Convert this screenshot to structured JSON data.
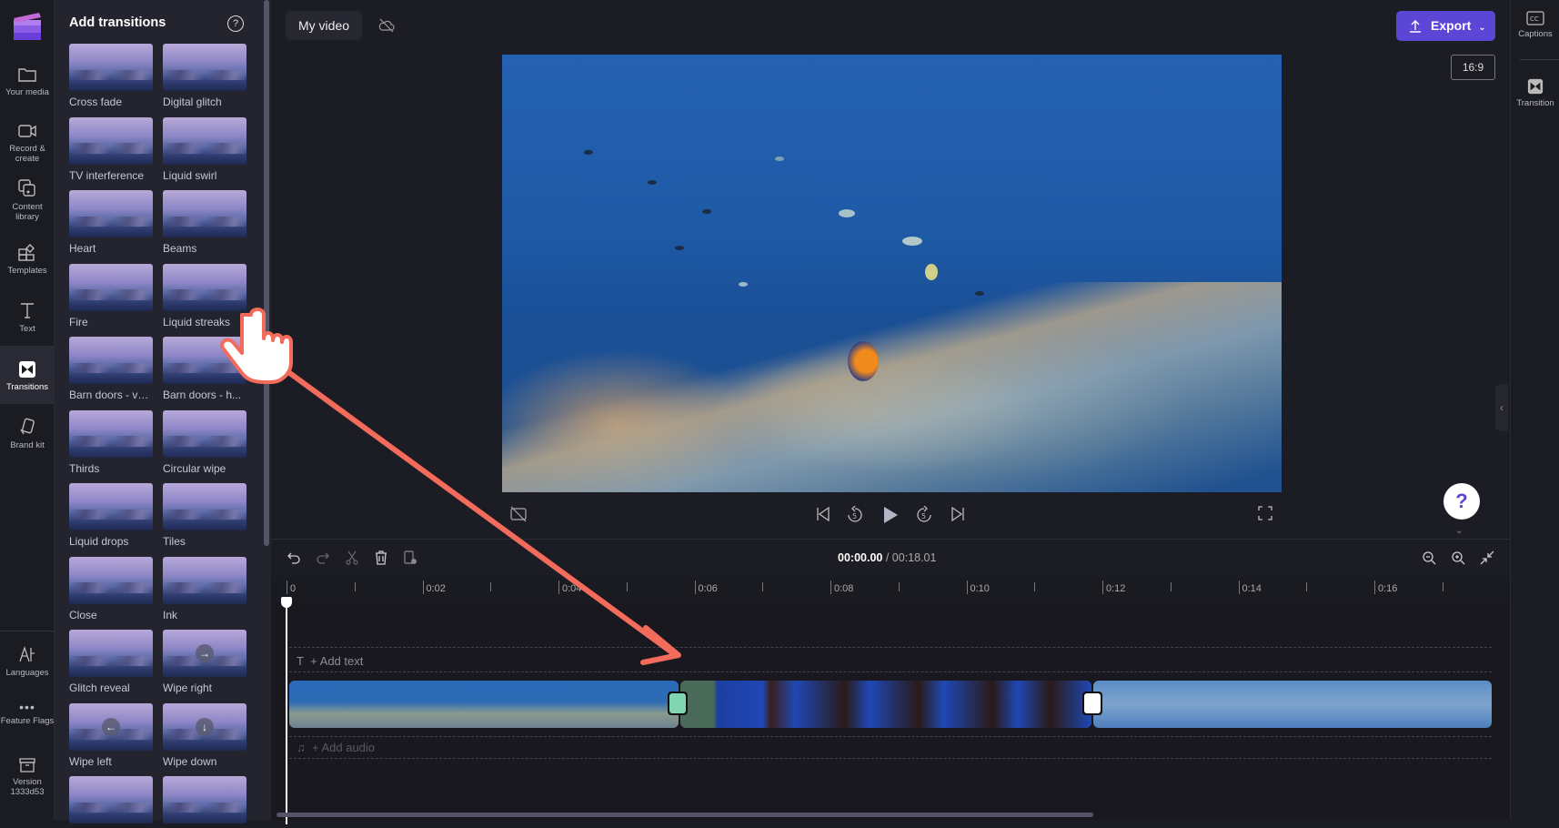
{
  "left_nav": {
    "items": [
      {
        "label": "Your media",
        "icon": "folder-icon"
      },
      {
        "label": "Record & create",
        "icon": "camera-icon"
      },
      {
        "label": "Content library",
        "icon": "content-library-icon"
      },
      {
        "label": "Templates",
        "icon": "templates-icon"
      },
      {
        "label": "Text",
        "icon": "text-icon"
      },
      {
        "label": "Transitions",
        "icon": "transitions-icon",
        "active": true
      },
      {
        "label": "Brand kit",
        "icon": "brand-kit-icon"
      },
      {
        "label": "Languages",
        "icon": "languages-icon"
      },
      {
        "label": "Feature Flags",
        "icon": "more-icon"
      },
      {
        "label": "Version 1333d53",
        "icon": "archive-icon"
      }
    ]
  },
  "panel": {
    "title": "Add transitions",
    "help_icon": "?",
    "transitions": [
      "Cross fade",
      "Digital glitch",
      "TV interference",
      "Liquid swirl",
      "Heart",
      "Beams",
      "Fire",
      "Liquid streaks",
      "Barn doors - ve...",
      "Barn doors - h...",
      "Thirds",
      "Circular wipe",
      "Liquid drops",
      "Tiles",
      "Close",
      "Ink",
      "Glitch reveal",
      "Wipe right",
      "Wipe left",
      "Wipe down",
      "",
      ""
    ]
  },
  "header": {
    "project_title": "My video",
    "export_label": "Export",
    "aspect_ratio": "16:9"
  },
  "player": {
    "current_time": "00:00.00",
    "total_time": "/ 00:18.01"
  },
  "timeline": {
    "ruler_labels": [
      "0",
      "0:02",
      "0:04",
      "0:06",
      "0:08",
      "0:10",
      "0:12",
      "0:14",
      "0:16"
    ],
    "add_text": "+ Add text",
    "add_audio": "+ Add audio"
  },
  "right_panel": {
    "items": [
      {
        "label": "Captions",
        "icon": "captions-icon"
      },
      {
        "label": "Transition",
        "icon": "transitions-icon"
      }
    ]
  },
  "help_button": "?",
  "colors": {
    "accent": "#5b46d6",
    "annotation": "#f26b5b"
  }
}
